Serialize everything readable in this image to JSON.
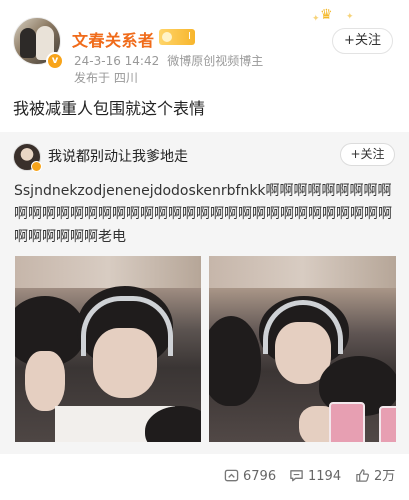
{
  "author": {
    "name": "文春关系者",
    "fan_badge": "I",
    "timestamp": "24-3-16 14:42",
    "source": "微博原创视频博主",
    "location": "发布于 四川"
  },
  "follow_label": "+关注",
  "post_text": "我被减重人包围就这个表情",
  "repost": {
    "name": "我说都别动让我爹地走",
    "follow_label": "+关注",
    "text": "Ssjndnekzodjenenejdodoskenrbfnkk啊啊啊啊啊啊啊啊啊啊啊啊啊啊啊啊啊啊啊啊啊啊啊啊啊啊啊啊啊啊啊啊啊啊啊啊啊啊啊啊啊啊老电"
  },
  "actions": {
    "reposts": "6796",
    "comments": "1194",
    "likes": "2万"
  },
  "colors": {
    "nickname": "#f06b1a",
    "badge": "#f8a41a",
    "card_bg": "#f5f5f5"
  }
}
